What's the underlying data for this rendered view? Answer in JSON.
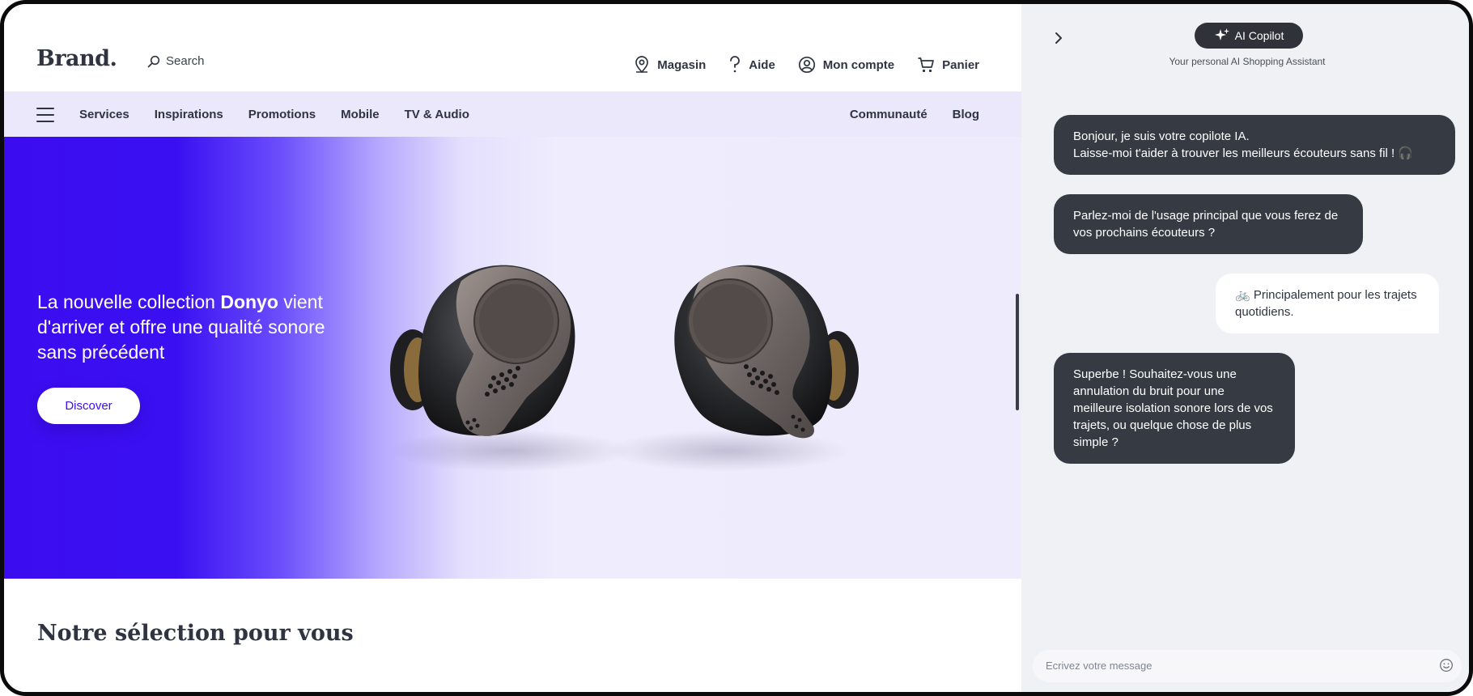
{
  "brand": "Brand.",
  "search": {
    "label": "Search"
  },
  "topnav": [
    {
      "label": "Magasin",
      "icon": "location-pin-icon"
    },
    {
      "label": "Aide",
      "icon": "question-icon"
    },
    {
      "label": "Mon compte",
      "icon": "user-circle-icon"
    },
    {
      "label": "Panier",
      "icon": "cart-icon"
    }
  ],
  "nav": {
    "left": [
      "Services",
      "Inspirations",
      "Promotions",
      "Mobile",
      "TV & Audio"
    ],
    "right": [
      "Communauté",
      "Blog"
    ]
  },
  "hero": {
    "line_pre": "La nouvelle collection ",
    "line_bold": "Donyo",
    "line_post": " vient d'arriver et offre une qualité sonore sans précédent",
    "cta": "Discover",
    "accent": "#3b0cf0"
  },
  "section_title": "Notre sélection pour vous",
  "copilot": {
    "title": "AI Copilot",
    "subtitle": "Your personal AI Shopping Assistant",
    "messages": [
      {
        "from": "bot",
        "lines": [
          "Bonjour, je suis votre copilote IA.",
          "Laisse-moi t'aider à trouver les meilleurs écouteurs sans fil ! 🎧"
        ]
      },
      {
        "from": "bot",
        "text": "Parlez-moi de l'usage principal que vous ferez de vos prochains écouteurs ?"
      },
      {
        "from": "user",
        "text": "🚲 Principalement pour les trajets quotidiens."
      },
      {
        "from": "bot",
        "text": "Superbe ! Souhaitez-vous une annulation du bruit pour une meilleure isolation sonore lors de vos trajets, ou quelque chose de plus simple ?"
      }
    ],
    "input_placeholder": "Ecrivez votre message"
  }
}
